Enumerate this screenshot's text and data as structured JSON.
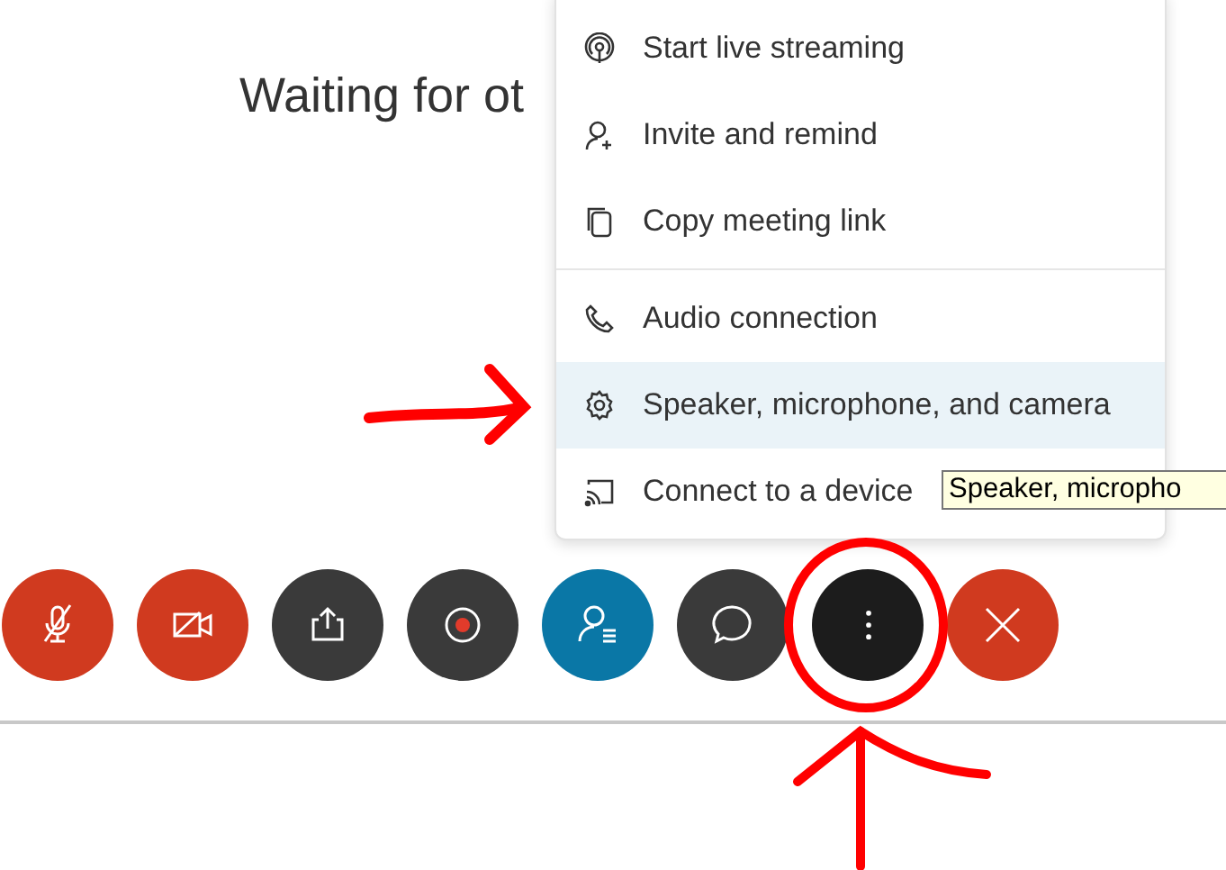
{
  "heading": "Waiting for ot",
  "menu": {
    "groups": [
      [
        {
          "kind": "streaming",
          "label": "Start live streaming",
          "selected": false
        },
        {
          "kind": "invite",
          "label": "Invite and remind",
          "selected": false
        },
        {
          "kind": "copy",
          "label": "Copy meeting link",
          "selected": false
        }
      ],
      [
        {
          "kind": "audio",
          "label": "Audio connection",
          "selected": false
        },
        {
          "kind": "settings",
          "label": "Speaker, microphone, and camera",
          "selected": true
        },
        {
          "kind": "cast",
          "label": "Connect to a device",
          "selected": false
        }
      ]
    ]
  },
  "tooltip": "Speaker, micropho",
  "toolbar": [
    {
      "kind": "mute",
      "color": "#d03a1f"
    },
    {
      "kind": "video",
      "color": "#d03a1f"
    },
    {
      "kind": "share",
      "color": "#3a3a3a"
    },
    {
      "kind": "record",
      "color": "#3a3a3a"
    },
    {
      "kind": "participants",
      "color": "#0a77a6"
    },
    {
      "kind": "chat",
      "color": "#3a3a3a"
    },
    {
      "kind": "more",
      "color": "#1c1c1c"
    },
    {
      "kind": "end",
      "color": "#d03a1f"
    }
  ]
}
